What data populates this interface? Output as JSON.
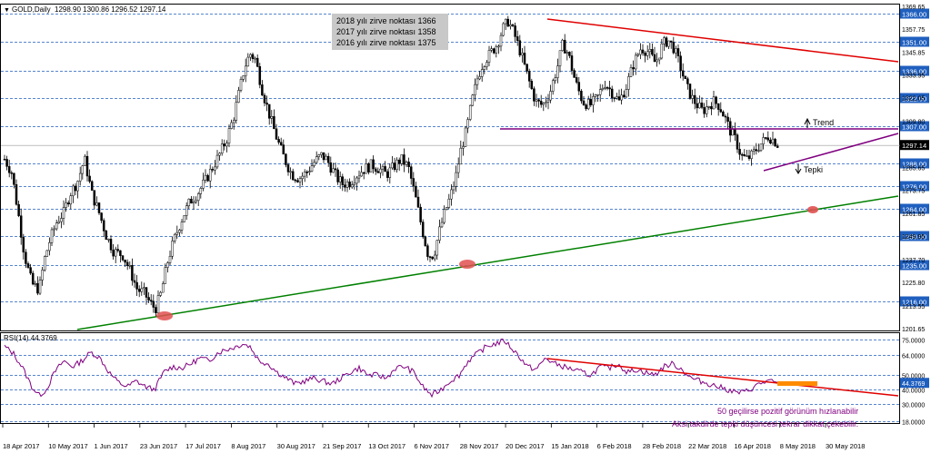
{
  "header": {
    "symbol": "GOLD,Daily",
    "ohlc": "1298.90 1300.86 1296.52 1297.14",
    "rsi_label": "RSI(14) 44.3769"
  },
  "info_box": {
    "lines": [
      "2018 yılı zirve  noktası 1366",
      "2017 yılı zirve  noktası 1358",
      "2016 yılı zirve  noktası 1375"
    ]
  },
  "annotations": {
    "trend": "Trend",
    "tepki": "Tepki",
    "rsi_note_1": "50 geçilirse pozitif görünüm hızlanabilir",
    "rsi_note_2": "Aksi takdirde tepki düşüncesi tekrar dikkat çekebilir."
  },
  "colors": {
    "candle": "#000000",
    "dashed_grid": "#1f5fbf",
    "trend_red": "#e00000",
    "trend_green": "#008000",
    "purple": "#800080",
    "rsi_line": "#800080",
    "orange": "#ff8c00",
    "badge_bg": "#1f5fbf",
    "note_text": "#800080",
    "info_bg": "#c8c8c8",
    "marker": "#e05050"
  },
  "chart_data": {
    "type": "candlestick",
    "ylim": [
      1201.65,
      1369.65
    ],
    "price_ticks": [
      "1369.65",
      "1357.75",
      "1345.85",
      "1333.95",
      "1322.05",
      "1309.80",
      "1297.90",
      "1285.65",
      "1273.75",
      "1261.85",
      "1249.95",
      "1237.70",
      "1225.80",
      "1213.55",
      "1201.65"
    ],
    "price_levels": [
      1366.0,
      1351.0,
      1336.0,
      1322.0,
      1307.0,
      1288.0,
      1276.0,
      1264.0,
      1250.0,
      1235.0,
      1216.0
    ],
    "current_price": "1297.14",
    "date_labels": [
      "18 Apr 2017",
      "10 May 2017",
      "1 Jun 2017",
      "23 Jun 2017",
      "17 Jul 2017",
      "8 Aug 2017",
      "30 Aug 2017",
      "21 Sep 2017",
      "13 Oct 2017",
      "6 Nov 2017",
      "28 Nov 2017",
      "20 Dec 2017",
      "15 Jan 2018",
      "6 Feb 2018",
      "28 Feb 2018",
      "22 Mar 2018",
      "16 Apr 2018",
      "8 May 2018",
      "30 May 2018"
    ],
    "anchors": [
      [
        0,
        1290
      ],
      [
        8,
        1283
      ],
      [
        15,
        1262
      ],
      [
        22,
        1240
      ],
      [
        30,
        1225
      ],
      [
        38,
        1222
      ],
      [
        44,
        1238
      ],
      [
        50,
        1248
      ],
      [
        58,
        1258
      ],
      [
        65,
        1262
      ],
      [
        72,
        1272
      ],
      [
        80,
        1278
      ],
      [
        88,
        1290
      ],
      [
        96,
        1272
      ],
      [
        104,
        1262
      ],
      [
        112,
        1250
      ],
      [
        120,
        1242
      ],
      [
        130,
        1240
      ],
      [
        138,
        1232
      ],
      [
        146,
        1222
      ],
      [
        154,
        1220
      ],
      [
        160,
        1215
      ],
      [
        166,
        1212
      ],
      [
        172,
        1220
      ],
      [
        180,
        1238
      ],
      [
        188,
        1250
      ],
      [
        196,
        1260
      ],
      [
        204,
        1268
      ],
      [
        212,
        1272
      ],
      [
        220,
        1278
      ],
      [
        228,
        1285
      ],
      [
        236,
        1292
      ],
      [
        244,
        1300
      ],
      [
        252,
        1312
      ],
      [
        258,
        1325
      ],
      [
        264,
        1338
      ],
      [
        270,
        1345
      ],
      [
        276,
        1342
      ],
      [
        284,
        1325
      ],
      [
        292,
        1312
      ],
      [
        300,
        1300
      ],
      [
        308,
        1290
      ],
      [
        316,
        1282
      ],
      [
        324,
        1280
      ],
      [
        332,
        1283
      ],
      [
        340,
        1288
      ],
      [
        348,
        1292
      ],
      [
        354,
        1290
      ],
      [
        360,
        1285
      ],
      [
        366,
        1280
      ],
      [
        372,
        1277
      ],
      [
        380,
        1278
      ],
      [
        388,
        1282
      ],
      [
        396,
        1285
      ],
      [
        404,
        1287
      ],
      [
        412,
        1285
      ],
      [
        420,
        1282
      ],
      [
        428,
        1286
      ],
      [
        436,
        1290
      ],
      [
        444,
        1286
      ],
      [
        452,
        1270
      ],
      [
        460,
        1252
      ],
      [
        466,
        1240
      ],
      [
        472,
        1240
      ],
      [
        478,
        1252
      ],
      [
        484,
        1262
      ],
      [
        490,
        1270
      ],
      [
        496,
        1280
      ],
      [
        502,
        1295
      ],
      [
        508,
        1305
      ],
      [
        514,
        1320
      ],
      [
        520,
        1332
      ],
      [
        526,
        1340
      ],
      [
        534,
        1345
      ],
      [
        542,
        1350
      ],
      [
        548,
        1358
      ],
      [
        554,
        1362
      ],
      [
        560,
        1356
      ],
      [
        568,
        1345
      ],
      [
        576,
        1332
      ],
      [
        584,
        1320
      ],
      [
        592,
        1318
      ],
      [
        600,
        1325
      ],
      [
        608,
        1338
      ],
      [
        614,
        1350
      ],
      [
        620,
        1345
      ],
      [
        628,
        1330
      ],
      [
        636,
        1320
      ],
      [
        644,
        1318
      ],
      [
        652,
        1322
      ],
      [
        660,
        1330
      ],
      [
        668,
        1325
      ],
      [
        676,
        1320
      ],
      [
        684,
        1328
      ],
      [
        692,
        1340
      ],
      [
        700,
        1348
      ],
      [
        708,
        1346
      ],
      [
        716,
        1340
      ],
      [
        724,
        1350
      ],
      [
        730,
        1352
      ],
      [
        736,
        1348
      ],
      [
        742,
        1340
      ],
      [
        750,
        1328
      ],
      [
        756,
        1322
      ],
      [
        762,
        1318
      ],
      [
        768,
        1315
      ],
      [
        774,
        1318
      ],
      [
        780,
        1320
      ],
      [
        786,
        1318
      ],
      [
        792,
        1312
      ],
      [
        798,
        1305
      ],
      [
        804,
        1300
      ],
      [
        810,
        1292
      ],
      [
        816,
        1290
      ],
      [
        822,
        1292
      ],
      [
        828,
        1296
      ],
      [
        834,
        1299
      ],
      [
        840,
        1302
      ],
      [
        846,
        1300
      ],
      [
        852,
        1297
      ]
    ],
    "rsi": {
      "ylim": [
        18,
        78
      ],
      "ticks": [
        "75.0000",
        "64.0000",
        "50.0000",
        "40.0000",
        "30.0000",
        "18.0000"
      ],
      "levels": [
        75,
        64,
        50,
        40,
        30,
        18
      ],
      "value": "44.3769",
      "anchors": [
        [
          0,
          70
        ],
        [
          10,
          65
        ],
        [
          20,
          55
        ],
        [
          30,
          42
        ],
        [
          38,
          36
        ],
        [
          46,
          40
        ],
        [
          55,
          52
        ],
        [
          65,
          60
        ],
        [
          75,
          56
        ],
        [
          85,
          60
        ],
        [
          95,
          66
        ],
        [
          105,
          62
        ],
        [
          115,
          52
        ],
        [
          125,
          45
        ],
        [
          135,
          42
        ],
        [
          145,
          46
        ],
        [
          155,
          42
        ],
        [
          165,
          40
        ],
        [
          175,
          52
        ],
        [
          185,
          56
        ],
        [
          195,
          55
        ],
        [
          205,
          58
        ],
        [
          215,
          62
        ],
        [
          225,
          60
        ],
        [
          235,
          66
        ],
        [
          245,
          68
        ],
        [
          255,
          70
        ],
        [
          262,
          72
        ],
        [
          270,
          70
        ],
        [
          280,
          60
        ],
        [
          290,
          58
        ],
        [
          300,
          52
        ],
        [
          310,
          48
        ],
        [
          320,
          44
        ],
        [
          330,
          46
        ],
        [
          340,
          48
        ],
        [
          350,
          46
        ],
        [
          360,
          44
        ],
        [
          370,
          48
        ],
        [
          380,
          52
        ],
        [
          390,
          55
        ],
        [
          400,
          50
        ],
        [
          410,
          50
        ],
        [
          420,
          48
        ],
        [
          430,
          55
        ],
        [
          440,
          56
        ],
        [
          450,
          52
        ],
        [
          460,
          42
        ],
        [
          470,
          36
        ],
        [
          480,
          40
        ],
        [
          490,
          46
        ],
        [
          500,
          50
        ],
        [
          510,
          60
        ],
        [
          520,
          65
        ],
        [
          530,
          70
        ],
        [
          540,
          72
        ],
        [
          550,
          74
        ],
        [
          556,
          70
        ],
        [
          565,
          64
        ],
        [
          575,
          56
        ],
        [
          585,
          54
        ],
        [
          595,
          62
        ],
        [
          605,
          58
        ],
        [
          615,
          56
        ],
        [
          625,
          54
        ],
        [
          635,
          52
        ],
        [
          645,
          50
        ],
        [
          655,
          56
        ],
        [
          665,
          55
        ],
        [
          675,
          58
        ],
        [
          685,
          52
        ],
        [
          695,
          54
        ],
        [
          705,
          52
        ],
        [
          715,
          50
        ],
        [
          725,
          56
        ],
        [
          735,
          58
        ],
        [
          745,
          54
        ],
        [
          755,
          48
        ],
        [
          765,
          46
        ],
        [
          775,
          44
        ],
        [
          785,
          42
        ],
        [
          795,
          40
        ],
        [
          805,
          38
        ],
        [
          812,
          38
        ],
        [
          820,
          40
        ],
        [
          830,
          44
        ],
        [
          840,
          46
        ],
        [
          852,
          44
        ]
      ]
    }
  }
}
